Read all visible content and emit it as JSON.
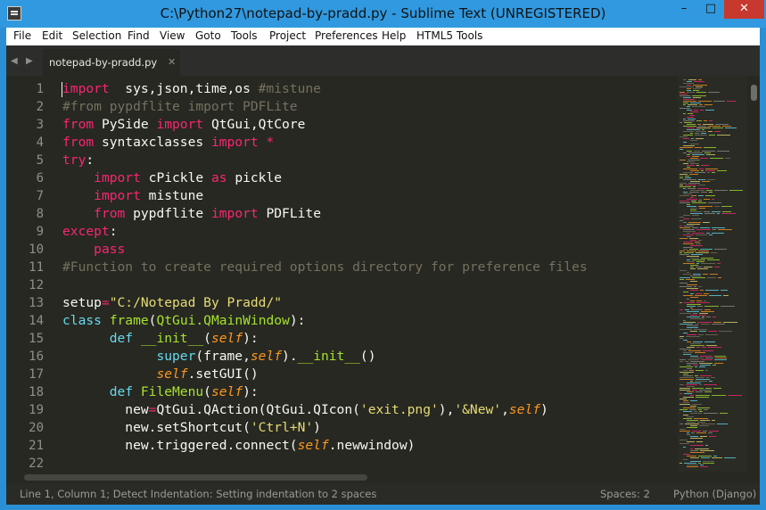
{
  "window": {
    "title": "C:\\Python27\\notepad-by-pradd.py - Sublime Text (UNREGISTERED)",
    "minimize": "–",
    "maximize": "□",
    "close": "✕"
  },
  "menu": [
    "File",
    "Edit",
    "Selection",
    "Find",
    "View",
    "Goto",
    "Tools",
    "Project",
    "Preferences",
    "Help",
    "HTML5 Tools"
  ],
  "tab": {
    "label": "notepad-by-pradd.py",
    "close": "✕",
    "nav_back": "◀",
    "nav_forward": "▶"
  },
  "editor": {
    "line_numbers": [
      "1",
      "2",
      "3",
      "4",
      "5",
      "6",
      "7",
      "8",
      "9",
      "10",
      "11",
      "12",
      "13",
      "14",
      "15",
      "16",
      "17",
      "18",
      "19",
      "20",
      "21",
      "22"
    ],
    "lines": [
      [
        [
          "kw",
          "import"
        ],
        [
          "",
          "  sys,json,time,os "
        ],
        [
          "cm",
          "#mistune"
        ]
      ],
      [
        [
          "cm",
          "#from pypdflite import PDFLite"
        ]
      ],
      [
        [
          "kw",
          "from"
        ],
        [
          "",
          " PySide "
        ],
        [
          "kw",
          "import"
        ],
        [
          "",
          " QtGui,QtCore"
        ]
      ],
      [
        [
          "kw",
          "from"
        ],
        [
          "",
          " syntaxclasses "
        ],
        [
          "kw",
          "import"
        ],
        [
          "",
          " "
        ],
        [
          "kw",
          "*"
        ]
      ],
      [
        [
          "kw",
          "try"
        ],
        [
          "",
          ":"
        ]
      ],
      [
        [
          "",
          "    "
        ],
        [
          "kw",
          "import"
        ],
        [
          "",
          " cPickle "
        ],
        [
          "kw",
          "as"
        ],
        [
          "",
          " pickle"
        ]
      ],
      [
        [
          "",
          "    "
        ],
        [
          "kw",
          "import"
        ],
        [
          "",
          " mistune"
        ]
      ],
      [
        [
          "",
          "    "
        ],
        [
          "kw",
          "from"
        ],
        [
          "",
          " pypdflite "
        ],
        [
          "kw",
          "import"
        ],
        [
          "",
          " PDFLite"
        ]
      ],
      [
        [
          "kw",
          "except"
        ],
        [
          "",
          ":"
        ]
      ],
      [
        [
          "",
          "    "
        ],
        [
          "kw",
          "pass"
        ]
      ],
      [
        [
          "cm",
          "#Function to create required options directory for preference files"
        ]
      ],
      [],
      [
        [
          "",
          "setup"
        ],
        [
          "kw",
          "="
        ],
        [
          "st",
          "\"C:/Notepad By Pradd/\""
        ]
      ],
      [
        [
          "bi",
          "class"
        ],
        [
          "",
          " "
        ],
        [
          "cl",
          "frame"
        ],
        [
          "",
          "("
        ],
        [
          "cl",
          "QtGui.QMainWindow"
        ],
        [
          "",
          "):"
        ]
      ],
      [
        [
          "",
          "      "
        ],
        [
          "bi",
          "def"
        ],
        [
          "",
          " "
        ],
        [
          "fn",
          "__init__"
        ],
        [
          "",
          "("
        ],
        [
          "sf",
          "self"
        ],
        [
          "",
          "):"
        ]
      ],
      [
        [
          "",
          "            "
        ],
        [
          "bi",
          "super"
        ],
        [
          "",
          "(frame,"
        ],
        [
          "sf",
          "self"
        ],
        [
          "",
          ")."
        ],
        [
          "fn",
          "__init__"
        ],
        [
          "",
          "()"
        ]
      ],
      [
        [
          "",
          "            "
        ],
        [
          "sf",
          "self"
        ],
        [
          "",
          ".setGUI()"
        ]
      ],
      [
        [
          "",
          "      "
        ],
        [
          "bi",
          "def"
        ],
        [
          "",
          " "
        ],
        [
          "fn",
          "FileMenu"
        ],
        [
          "",
          "("
        ],
        [
          "sf",
          "self"
        ],
        [
          "",
          "):"
        ]
      ],
      [
        [
          "",
          "        new"
        ],
        [
          "kw",
          "="
        ],
        [
          "",
          "QtGui.QAction(QtGui.QIcon("
        ],
        [
          "st",
          "'exit.png'"
        ],
        [
          "",
          "),"
        ],
        [
          "st",
          "'&New'"
        ],
        [
          "",
          ","
        ],
        [
          "sf",
          "self"
        ],
        [
          "",
          ")"
        ]
      ],
      [
        [
          "",
          "        new.setShortcut("
        ],
        [
          "st",
          "'Ctrl+N'"
        ],
        [
          "",
          ")"
        ]
      ],
      [
        [
          "",
          "        new.triggered.connect("
        ],
        [
          "sf",
          "self"
        ],
        [
          "",
          ".newwindow)"
        ]
      ],
      []
    ]
  },
  "status": {
    "message": "Line 1, Column 1; Detect Indentation: Setting indentation to 2 spaces",
    "spaces": "Spaces: 2",
    "syntax": "Python (Django)"
  }
}
